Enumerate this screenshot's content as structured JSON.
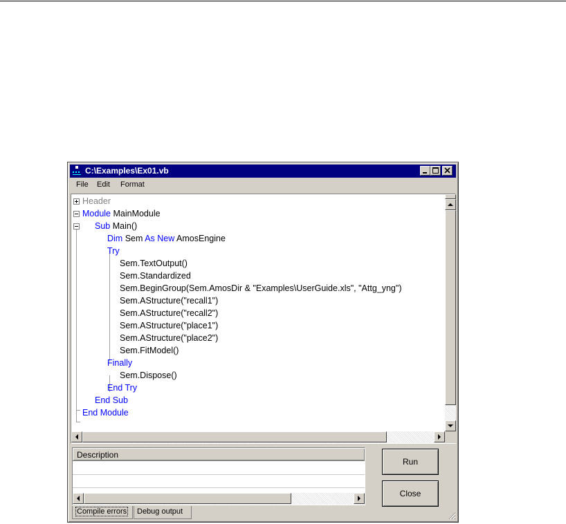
{
  "window": {
    "title": "C:\\Examples\\Ex01.vb"
  },
  "menu": [
    "File",
    "Edit",
    "Format"
  ],
  "code": {
    "header": "Header",
    "module_kw": "Module",
    "module_name": " MainModule",
    "sub_kw": "Sub",
    "sub_name": " Main()",
    "dim_kw": "Dim",
    "dim_mid": " Sem ",
    "as_new_kw": "As New",
    "dim_type": " AmosEngine",
    "try_kw": "Try",
    "lines": [
      "Sem.TextOutput()",
      "Sem.Standardized",
      "Sem.BeginGroup(Sem.AmosDir & \"Examples\\UserGuide.xls\", \"Attg_yng\")",
      "Sem.AStructure(\"recall1\")",
      "Sem.AStructure(\"recall2\")",
      "Sem.AStructure(\"place1\")",
      "Sem.AStructure(\"place2\")",
      "Sem.FitModel()"
    ],
    "finally_kw": "Finally",
    "dispose_line": "Sem.Dispose()",
    "end_try_kw": "End Try",
    "end_sub_kw": "End Sub",
    "end_module_kw": "End Module"
  },
  "description_header": "Description",
  "tabs": {
    "compile_errors": "Compile errors",
    "debug_output": "Debug output"
  },
  "buttons": {
    "run": "Run",
    "close": "Close"
  },
  "colors": {
    "keyword": "#0000ff",
    "titlebar": "#000080",
    "chrome": "#d4d0c8"
  }
}
